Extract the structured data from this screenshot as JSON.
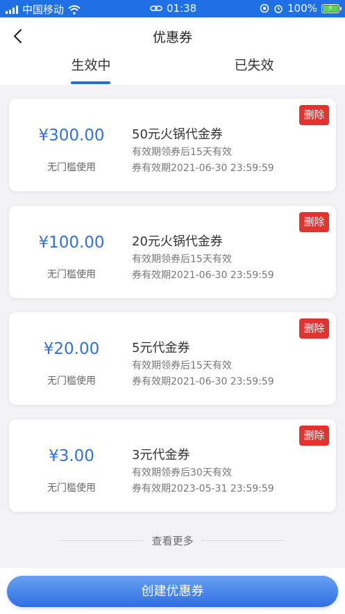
{
  "status_bar": {
    "carrier": "中国移动",
    "time": "01:38",
    "battery": "100%"
  },
  "header": {
    "title": "优惠券",
    "tabs": [
      {
        "label": "生效中",
        "active": true
      },
      {
        "label": "已失效",
        "active": false
      }
    ]
  },
  "coupons": [
    {
      "price": "¥300.00",
      "threshold": "无门槛使用",
      "name": "50元火锅代金券",
      "validity": "有效期领券后15天有效",
      "expiry": "券有效期2021-06-30 23:59:59",
      "delete_label": "删除"
    },
    {
      "price": "¥100.00",
      "threshold": "无门槛使用",
      "name": "20元火锅代金券",
      "validity": "有效期领券后15天有效",
      "expiry": "券有效期2021-06-30 23:59:59",
      "delete_label": "删除"
    },
    {
      "price": "¥20.00",
      "threshold": "无门槛使用",
      "name": "5元代金券",
      "validity": "有效期领券后15天有效",
      "expiry": "券有效期2021-06-30 23:59:59",
      "delete_label": "删除"
    },
    {
      "price": "¥3.00",
      "threshold": "无门槛使用",
      "name": "3元代金券",
      "validity": "有效期领券后30天有效",
      "expiry": "券有效期2023-05-31 23:59:59",
      "delete_label": "删除"
    }
  ],
  "more_label": "查看更多",
  "create_button_label": "创建优惠券",
  "colors": {
    "accent": "#1f6fe5",
    "price": "#2f72e0",
    "delete": "#e4322f"
  }
}
